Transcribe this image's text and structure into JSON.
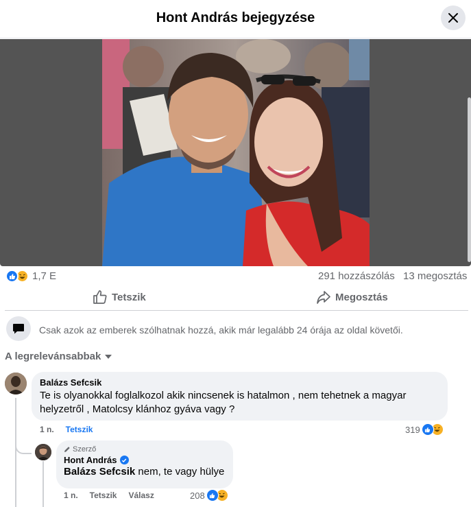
{
  "header": {
    "title": "Hont András bejegyzése",
    "close_icon": "close-icon"
  },
  "post": {
    "reactions": {
      "icons": [
        "like-icon",
        "haha-icon"
      ],
      "count": "1,7 E"
    },
    "comments_count": "291 hozzászólás",
    "shares_count": "13 megosztás",
    "actions": {
      "like": "Tetszik",
      "share": "Megosztás"
    },
    "notice": "Csak azok az emberek szólhatnak hozzá, akik már legalább 24 órája az oldal követői.",
    "sort_label": "A legrelevánsabbak"
  },
  "comments": [
    {
      "name": "Balázs Sefcsik",
      "text": "Te is olyanokkal foglalkozol akik nincsenek is hatalmon , nem tehetnek a magyar helyzetről , Matolcsy klánhoz gyáva vagy ?",
      "time": "1 n.",
      "like_label": "Tetszik",
      "reaction_count": "319"
    }
  ],
  "reply": {
    "badge": "Szerző",
    "name": "Hont András",
    "mention": "Balázs Sefcsik",
    "text": " nem, te vagy hülye",
    "time": "1 n.",
    "like_label": "Tetszik",
    "reply_label": "Válasz",
    "reaction_count": "208"
  },
  "colors": {
    "accent": "#1877f2",
    "haha": "#f7b125",
    "muted_text": "#65676b",
    "bubble_bg": "#f0f2f5",
    "photo_bg": "#545454"
  }
}
